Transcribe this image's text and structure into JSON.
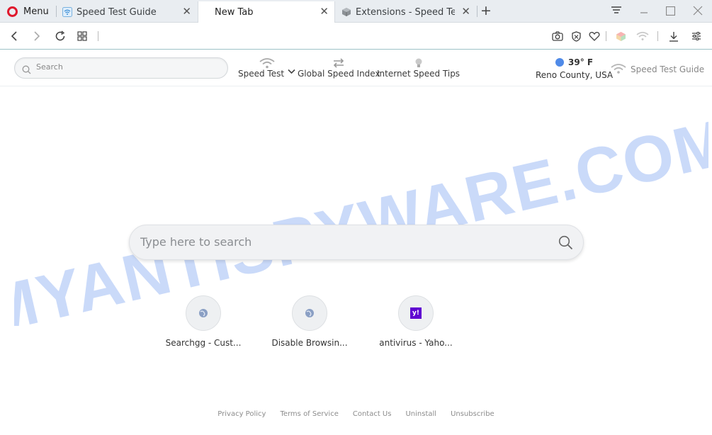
{
  "browser": {
    "menu_label": "Menu",
    "tabs": [
      {
        "title": "Speed Test Guide"
      },
      {
        "title": "New Tab"
      },
      {
        "title": "Extensions - Speed Te"
      }
    ],
    "accent": "#e0182d"
  },
  "toolbar": {
    "search_placeholder": "Search",
    "speed_test_label": "Speed Test",
    "global_speed_label": "Global Speed Index",
    "tips_label": "Internet Speed Tips",
    "weather_temp": "39° F",
    "weather_location": "Reno County, USA",
    "brand_label": "Speed Test Guide"
  },
  "main": {
    "search_placeholder": "Type here to search",
    "tiles": [
      {
        "label": "Searchgg - Cust..."
      },
      {
        "label": "Disable Browsin..."
      },
      {
        "label": "antivirus - Yaho..."
      }
    ],
    "yahoo_glyph": "y!"
  },
  "footer": {
    "links": [
      "Privacy Policy",
      "Terms of Service",
      "Contact Us",
      "Uninstall",
      "Unsubscribe"
    ]
  },
  "watermark": {
    "text": "MYANTISPYWARE.COM",
    "color": "#3f7be8"
  }
}
